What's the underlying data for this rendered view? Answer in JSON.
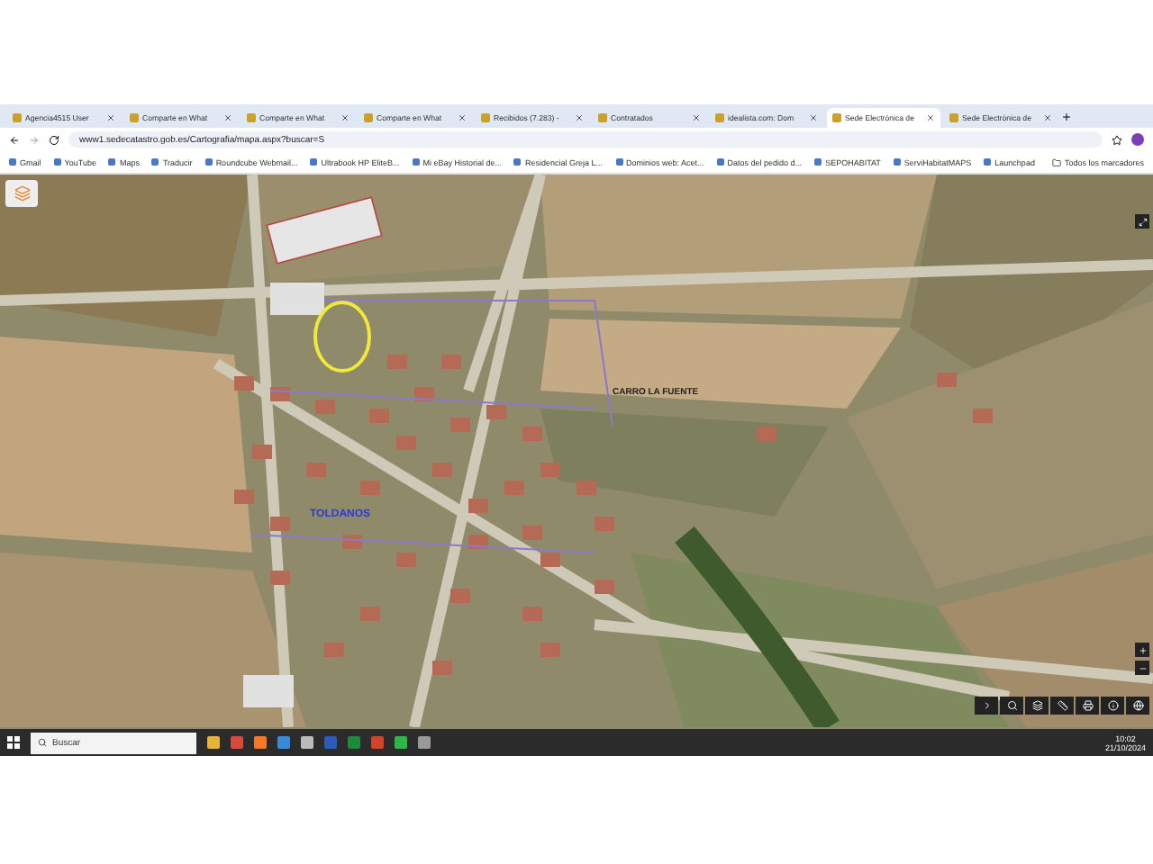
{
  "browser": {
    "tabs": [
      {
        "title": "Agencia4515 User",
        "selected": false
      },
      {
        "title": "Comparte en What",
        "selected": false
      },
      {
        "title": "Comparte en What",
        "selected": false
      },
      {
        "title": "Comparte en What",
        "selected": false
      },
      {
        "title": "Recibidos (7.283) -",
        "selected": false
      },
      {
        "title": "Contratados",
        "selected": false
      },
      {
        "title": "idealista.com: Dom",
        "selected": false
      },
      {
        "title": "Sede Electrónica de",
        "selected": true
      },
      {
        "title": "Sede Electrónica de",
        "selected": false
      }
    ],
    "address": "www1.sedecatastro.gob.es/Cartografia/mapa.aspx?buscar=S",
    "bookmarks": [
      "Gmail",
      "YouTube",
      "Maps",
      "Traducir",
      "Roundcube Webmail...",
      "Ultrabook HP EliteB...",
      "Mi eBay Historial de...",
      "Residencial Greja L...",
      "Dominios web: Acet...",
      "Datos del pedido d...",
      "SEPOHABITAT",
      "ServiHabitatMAPS",
      "Launchpad"
    ],
    "all_bookmarks": "Todos los marcadores"
  },
  "map": {
    "labels": [
      {
        "text": "TOLDANOS",
        "kind": "town"
      },
      {
        "text": "CARRO LA FUENTE",
        "kind": "place"
      }
    ]
  },
  "taskbar": {
    "search_placeholder": "Buscar",
    "time": "10:02",
    "date": "21/10/2024"
  }
}
